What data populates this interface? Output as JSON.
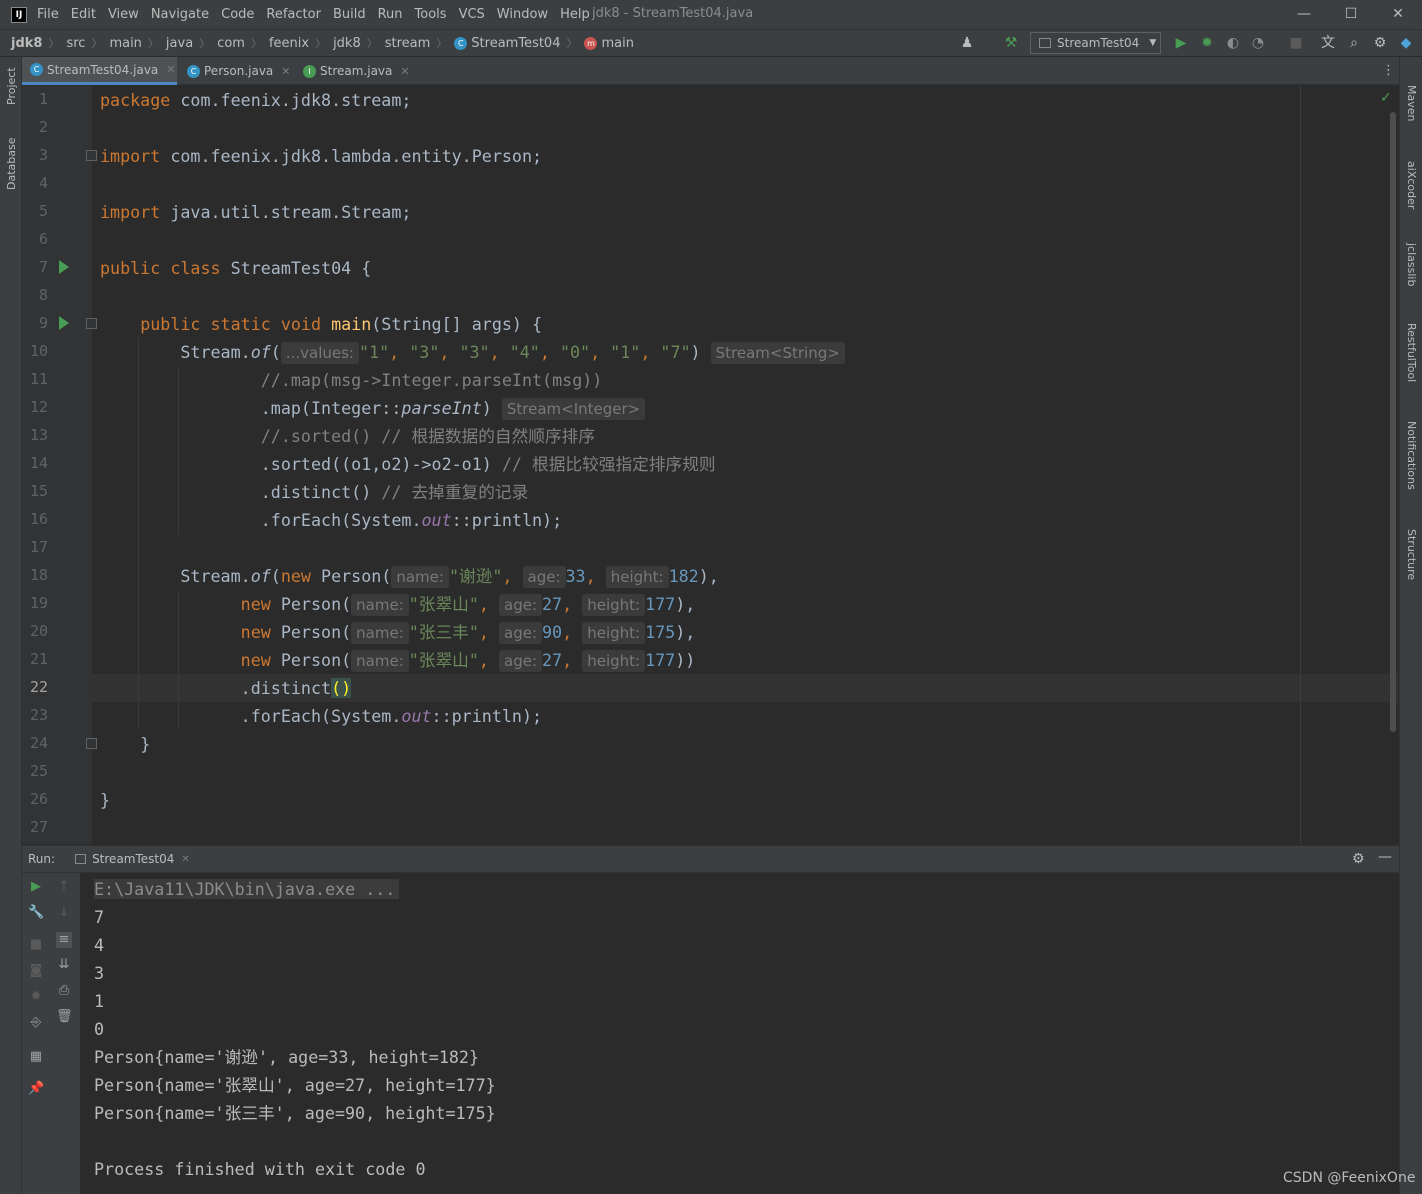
{
  "menu": [
    "File",
    "Edit",
    "View",
    "Navigate",
    "Code",
    "Refactor",
    "Build",
    "Run",
    "Tools",
    "VCS",
    "Window",
    "Help"
  ],
  "window_title": "jdk8 - StreamTest04.java",
  "logo_text": "IJ",
  "window_controls": {
    "minimize": "—",
    "maximize": "☐",
    "close": "✕"
  },
  "breadcrumbs": [
    "jdk8",
    "src",
    "main",
    "java",
    "com",
    "feenix",
    "jdk8",
    "stream",
    "StreamTest04",
    "main"
  ],
  "run_config": "StreamTest04",
  "tabs": [
    {
      "label": "StreamTest04.java",
      "icon": "class-icon",
      "active": true
    },
    {
      "label": "Person.java",
      "icon": "class-icon",
      "active": false
    },
    {
      "label": "Stream.java",
      "icon": "interface-icon",
      "active": false
    }
  ],
  "left_tool_windows": [
    "Project",
    "Database"
  ],
  "right_tool_windows": [
    "Maven",
    "aiXcoder",
    "jclasslib",
    "RestfulTool",
    "Notifications",
    "Structure"
  ],
  "line_numbers": [
    "1",
    "2",
    "3",
    "4",
    "5",
    "6",
    "7",
    "8",
    "9",
    "10",
    "11",
    "12",
    "13",
    "14",
    "15",
    "16",
    "17",
    "18",
    "19",
    "20",
    "21",
    "22",
    "23",
    "24",
    "25",
    "26",
    "27"
  ],
  "current_line": "22",
  "code": {
    "l1_kw": "package",
    "l1_rest": " com.feenix.jdk8.stream;",
    "l3_kw": "import",
    "l3_rest": " com.feenix.jdk8.lambda.entity.Person;",
    "l5_kw": "import",
    "l5_rest": " java.util.stream.Stream;",
    "l7_kw": "public class",
    "l7_rest": " StreamTest04 {",
    "l9_kw": "public static void",
    "l9_fn": "main",
    "l9_rest": "(String[] args) {",
    "l10_a": "Stream.",
    "l10_of": "of",
    "l10_b": "(",
    "l10_hint": "...values:",
    "l10_args": [
      {
        "s": "\"1\""
      },
      {
        "s": "\"3\""
      },
      {
        "s": "\"3\""
      },
      {
        "s": "\"4\""
      },
      {
        "s": "\"0\""
      },
      {
        "s": "\"1\""
      },
      {
        "s": "\"7\""
      }
    ],
    "l10_close": ")",
    "l10_type": "Stream<String>",
    "l11": "//.map(msg->Integer.parseInt(msg))",
    "l12_a": ".map(Integer::",
    "l12_it": "parseInt",
    "l12_b": ")",
    "l12_type": "Stream<Integer>",
    "l13": "//.sorted() // 根据数据的自然顺序排序",
    "l14_a": ".sorted((o1,o2)->o2-o1) ",
    "l14_cmt": "// 根据比较强指定排序规则",
    "l15_a": ".distinct() ",
    "l15_cmt": "// 去掉重复的记录",
    "l16_a": ".forEach(System.",
    "l16_st": "out",
    "l16_b": "::println);",
    "l18_a": "Stream.",
    "l18_of": "of",
    "l18_b": "(",
    "new_kw": "new",
    "person_ctor": " Person(",
    "hint_name": "name:",
    "hint_age": "age:",
    "hint_height": "height:",
    "persons": [
      {
        "name": "\"谢逊\"",
        "age": "33",
        "height": "182",
        "end": "),"
      },
      {
        "name": "\"张翠山\"",
        "age": "27",
        "height": "177",
        "end": "),"
      },
      {
        "name": "\"张三丰\"",
        "age": "90",
        "height": "175",
        "end": "),"
      },
      {
        "name": "\"张翠山\"",
        "age": "27",
        "height": "177",
        "end": "))"
      }
    ],
    "l22_a": ".distinct",
    "l22_br": "()",
    "l23_a": ".forEach(System.",
    "l23_st": "out",
    "l23_b": "::println);",
    "l24": "}",
    "l26": "}"
  },
  "run_panel": {
    "label": "Run:",
    "tab": "StreamTest04",
    "cmd": "E:\\Java11\\JDK\\bin\\java.exe ...",
    "output": [
      "7",
      "4",
      "3",
      "1",
      "0",
      "Person{name='谢逊', age=33, height=182}",
      "Person{name='张翠山', age=27, height=177}",
      "Person{name='张三丰', age=90, height=175}",
      "",
      "Process finished with exit code 0"
    ]
  },
  "watermark": "CSDN @FeenixOne",
  "colors": {
    "keyword": "#cc7832",
    "string": "#6a8759",
    "number": "#6897bb",
    "comment": "#808080",
    "function": "#ffc66d",
    "static_field": "#9876aa",
    "accent": "#4a88c7",
    "run_green": "#499c54"
  }
}
